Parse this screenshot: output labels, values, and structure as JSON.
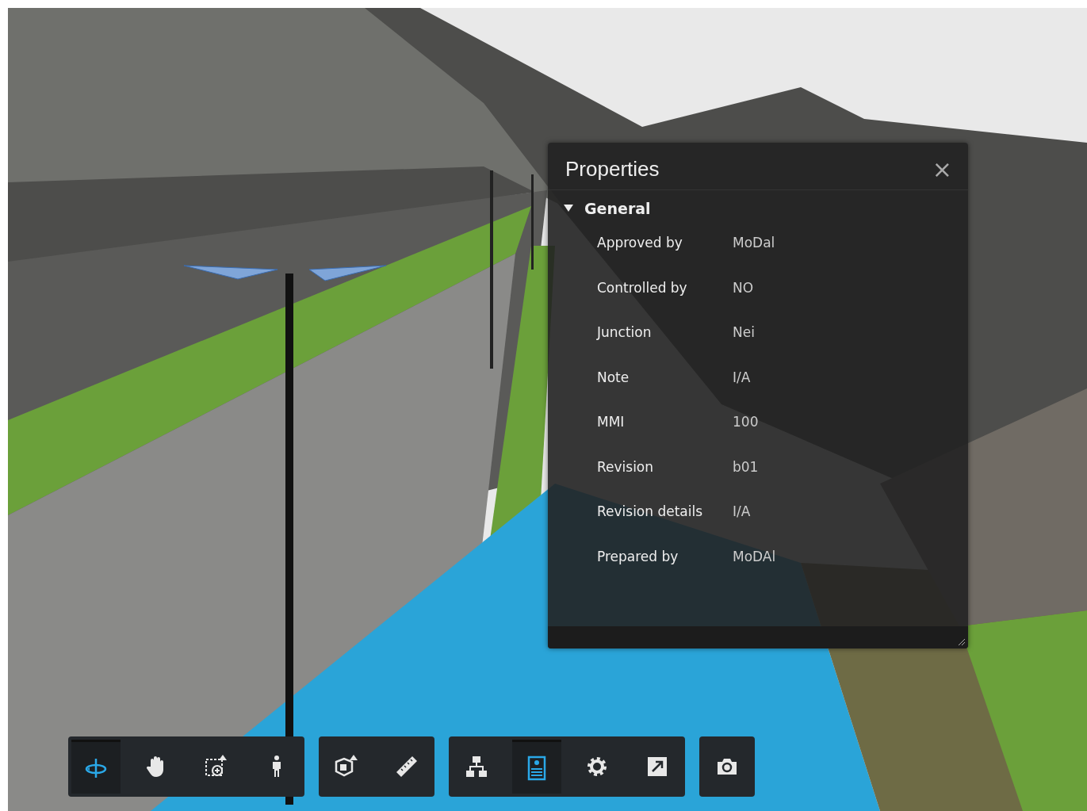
{
  "properties_panel": {
    "title": "Properties",
    "close": "×",
    "sections": [
      {
        "title": "General",
        "expanded": true,
        "rows": [
          {
            "label": "Approved by",
            "value": "MoDal"
          },
          {
            "label": "Controlled by",
            "value": "NO"
          },
          {
            "label": "Junction",
            "value": "Nei"
          },
          {
            "label": "Note",
            "value": "I/A"
          },
          {
            "label": "MMI",
            "value": "100"
          },
          {
            "label": "Revision",
            "value": "b01"
          },
          {
            "label": "Revision details",
            "value": "I/A"
          },
          {
            "label": "Prepared by",
            "value": "MoDAl"
          }
        ]
      }
    ]
  },
  "toolbar": {
    "groups": [
      {
        "tools": [
          {
            "selected": true
          },
          {
            "selected": false
          },
          {
            "selected": false
          },
          {
            "selected": false
          }
        ]
      },
      {
        "tools": [
          {
            "selected": false
          },
          {
            "selected": false
          }
        ]
      },
      {
        "tools": [
          {
            "selected": false
          },
          {
            "selected": true
          },
          {
            "selected": false
          },
          {
            "selected": false
          }
        ]
      },
      {
        "tools": [
          {
            "selected": false
          }
        ]
      }
    ]
  }
}
